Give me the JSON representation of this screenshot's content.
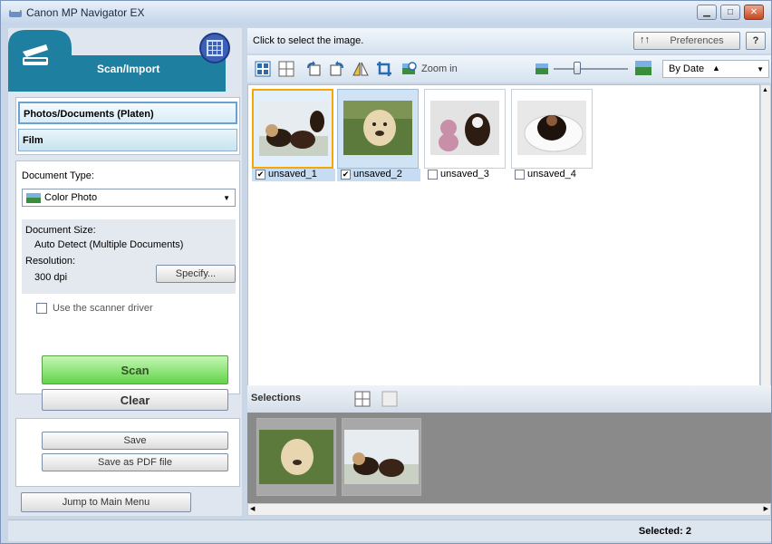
{
  "window": {
    "title": "Canon MP Navigator EX"
  },
  "scan_panel": {
    "title": "Scan/Import"
  },
  "menu": {
    "items": [
      {
        "label": "Photos/Documents (Platen)"
      },
      {
        "label": "Film"
      }
    ]
  },
  "settings": {
    "document_type_label": "Document Type:",
    "document_type_value": "Color Photo",
    "document_size_label": "Document Size:",
    "document_size_value": "Auto Detect (Multiple Documents)",
    "resolution_label": "Resolution:",
    "resolution_value": "300 dpi",
    "specify_button": "Specify...",
    "scanner_driver_label": "Use the scanner driver",
    "scanner_driver_checked": false,
    "scan_button": "Scan",
    "clear_button": "Clear"
  },
  "output": {
    "save_button": "Save",
    "save_pdf_button": "Save as PDF file"
  },
  "navigation": {
    "jump_button": "Jump to Main Menu"
  },
  "header": {
    "hint": "Click to select the image.",
    "preferences_button": "Preferences",
    "help_button": "?"
  },
  "toolbar": {
    "zoom_label": "Zoom in",
    "sort_value": "By Date"
  },
  "thumbnails": [
    {
      "label": "unsaved_1",
      "checked": true
    },
    {
      "label": "unsaved_2",
      "checked": true
    },
    {
      "label": "unsaved_3",
      "checked": false
    },
    {
      "label": "unsaved_4",
      "checked": false
    }
  ],
  "selections": {
    "label": "Selections"
  },
  "status": {
    "selected": "Selected: 2"
  }
}
